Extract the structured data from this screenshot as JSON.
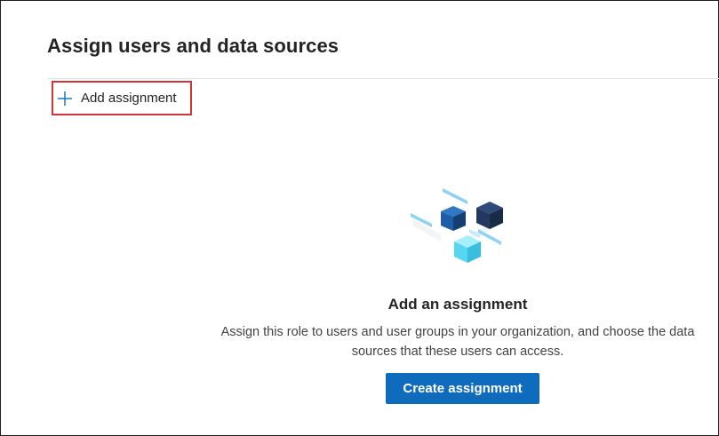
{
  "page": {
    "title": "Assign users and data sources"
  },
  "toolbar": {
    "add_label": "Add assignment",
    "add_icon": "plus-icon"
  },
  "empty_state": {
    "illustration": "cubes-illustration",
    "title": "Add an assignment",
    "description": "Assign this role to users and user groups in your organization, and choose the data sources that these users can access.",
    "create_label": "Create assignment"
  },
  "colors": {
    "accent": "#0f6cbd",
    "highlight_border": "#d13438"
  }
}
